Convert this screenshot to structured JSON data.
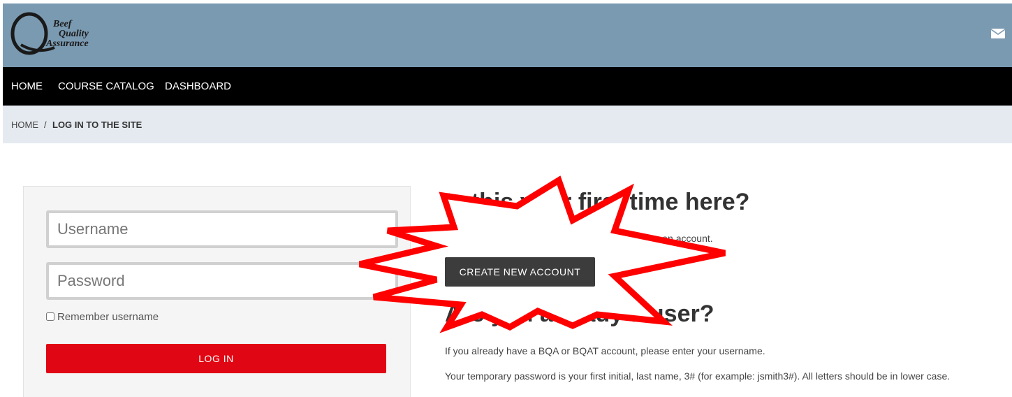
{
  "brand": {
    "logo_lines": [
      "Beef",
      "Quality",
      "Assurance"
    ],
    "header_color": "#7a9ab1",
    "accent_color": "#e10613"
  },
  "header": {
    "mail_icon": "envelope-icon"
  },
  "nav": {
    "items": [
      "HOME",
      "COURSE CATALOG",
      "DASHBOARD"
    ]
  },
  "breadcrumb": {
    "home": "HOME",
    "separator": "/",
    "current": "LOG IN TO THE SITE"
  },
  "login": {
    "username_placeholder": "Username",
    "password_placeholder": "Password",
    "remember_label": "Remember username",
    "login_button": "LOG IN"
  },
  "first_time": {
    "heading": "Is this your first time here?",
    "text": "For full access to this site, you first need to create an account.",
    "button": "CREATE NEW ACCOUNT"
  },
  "existing": {
    "heading": "Are you already a user?",
    "line1": "If you already have a BQA or BQAT account, please enter your username.",
    "line2": "Your temporary password is your first initial, last name, 3# (for example: jsmith3#). All letters should be in lower case."
  }
}
